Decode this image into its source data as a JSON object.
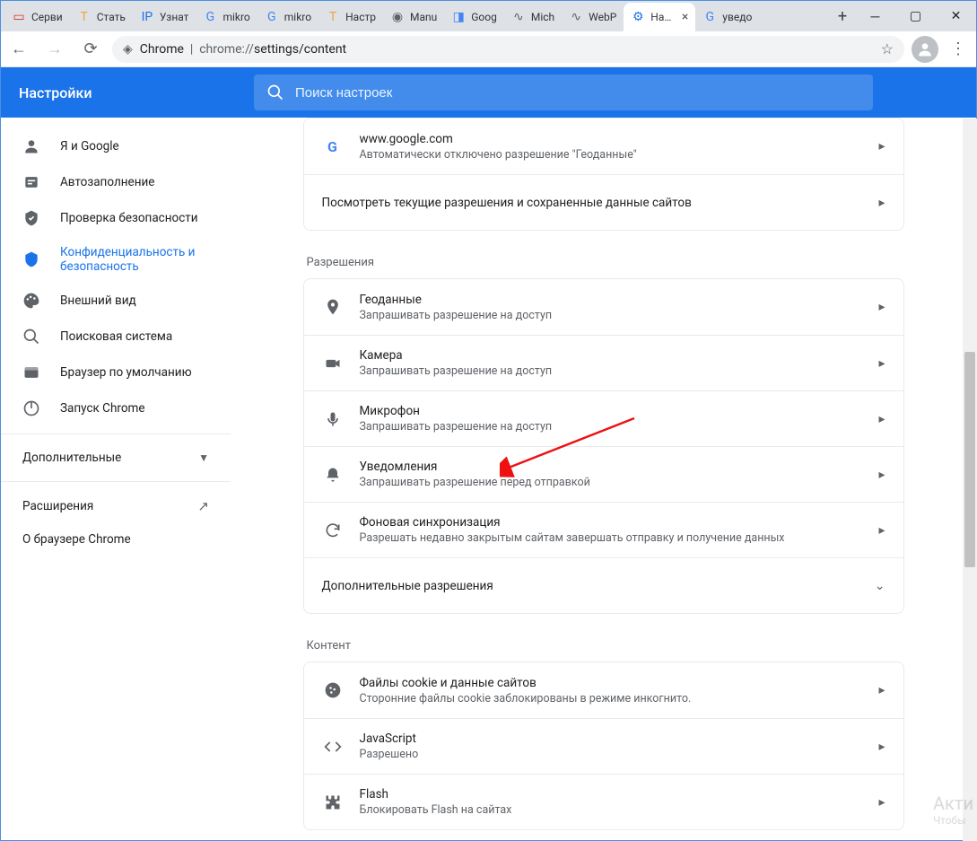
{
  "tabs": [
    {
      "title": "Серви",
      "fav_color": "#d93025",
      "fav_text": "▭"
    },
    {
      "title": "Стать",
      "fav_color": "#f2a33c",
      "fav_text": "T"
    },
    {
      "title": "Узнат",
      "fav_color": "#1a73e8",
      "fav_text": "IP"
    },
    {
      "title": "mikro",
      "fav_color": "#4285f4",
      "fav_text": "G"
    },
    {
      "title": "mikro",
      "fav_color": "#4285f4",
      "fav_text": "G"
    },
    {
      "title": "Настр",
      "fav_color": "#f2a33c",
      "fav_text": "T"
    },
    {
      "title": "Manu",
      "fav_color": "#5f6368",
      "fav_text": "◉"
    },
    {
      "title": "Goog",
      "fav_color": "#4285f4",
      "fav_text": "◨"
    },
    {
      "title": "Mich",
      "fav_color": "#5f6368",
      "fav_text": "∿"
    },
    {
      "title": "WebP",
      "fav_color": "#5f6368",
      "fav_text": "∿"
    }
  ],
  "active_tab": {
    "title": "Настройки",
    "fav_text": "⚙",
    "fav_color": "#1a73e8"
  },
  "trailing_tab": {
    "title": "уведо",
    "fav_color": "#4285f4",
    "fav_text": "G"
  },
  "url": {
    "scheme": "Chrome",
    "path_dim": "chrome://",
    "path": "settings/content"
  },
  "settings": {
    "header_title": "Настройки",
    "search_placeholder": "Поиск настроек"
  },
  "sidebar": {
    "items": [
      {
        "label": "Я и Google",
        "icon": "person",
        "active": false
      },
      {
        "label": "Автозаполнение",
        "icon": "autofill",
        "active": false
      },
      {
        "label": "Проверка безопасности",
        "icon": "shield-check",
        "active": false
      },
      {
        "label": "Конфиденциальность и безопасность",
        "icon": "shield",
        "active": true
      },
      {
        "label": "Внешний вид",
        "icon": "palette",
        "active": false
      },
      {
        "label": "Поисковая система",
        "icon": "search",
        "active": false
      },
      {
        "label": "Браузер по умолчанию",
        "icon": "browser",
        "active": false
      },
      {
        "label": "Запуск Chrome",
        "icon": "power",
        "active": false
      }
    ],
    "advanced_label": "Дополнительные",
    "extensions_label": "Расширения",
    "about_label": "О браузере Chrome"
  },
  "content": {
    "recent": [
      {
        "icon": "G",
        "title": "www.google.com",
        "sub": "Автоматически отключено разрешение \"Геоданные\""
      }
    ],
    "recent_footer": "Посмотреть текущие разрешения и сохраненные данные сайтов",
    "permissions_header": "Разрешения",
    "permissions": [
      {
        "icon": "location",
        "title": "Геоданные",
        "sub": "Запрашивать разрешение на доступ"
      },
      {
        "icon": "camera",
        "title": "Камера",
        "sub": "Запрашивать разрешение на доступ"
      },
      {
        "icon": "mic",
        "title": "Микрофон",
        "sub": "Запрашивать разрешение на доступ"
      },
      {
        "icon": "bell",
        "title": "Уведомления",
        "sub": "Запрашивать разрешение перед отправкой"
      },
      {
        "icon": "sync",
        "title": "Фоновая синхронизация",
        "sub": "Разрешать недавно закрытым сайтам завершать отправку и получение данных"
      }
    ],
    "additional_label": "Дополнительные разрешения",
    "content_header": "Контент",
    "content_rows": [
      {
        "icon": "cookie",
        "title": "Файлы cookie и данные сайтов",
        "sub": "Сторонние файлы cookie заблокированы в режиме инкогнито."
      },
      {
        "icon": "code",
        "title": "JavaScript",
        "sub": "Разрешено"
      },
      {
        "icon": "puzzle",
        "title": "Flash",
        "sub": "Блокировать Flash на сайтах"
      }
    ]
  },
  "watermark": {
    "l1": "Акти",
    "l2": "Чтобы"
  }
}
